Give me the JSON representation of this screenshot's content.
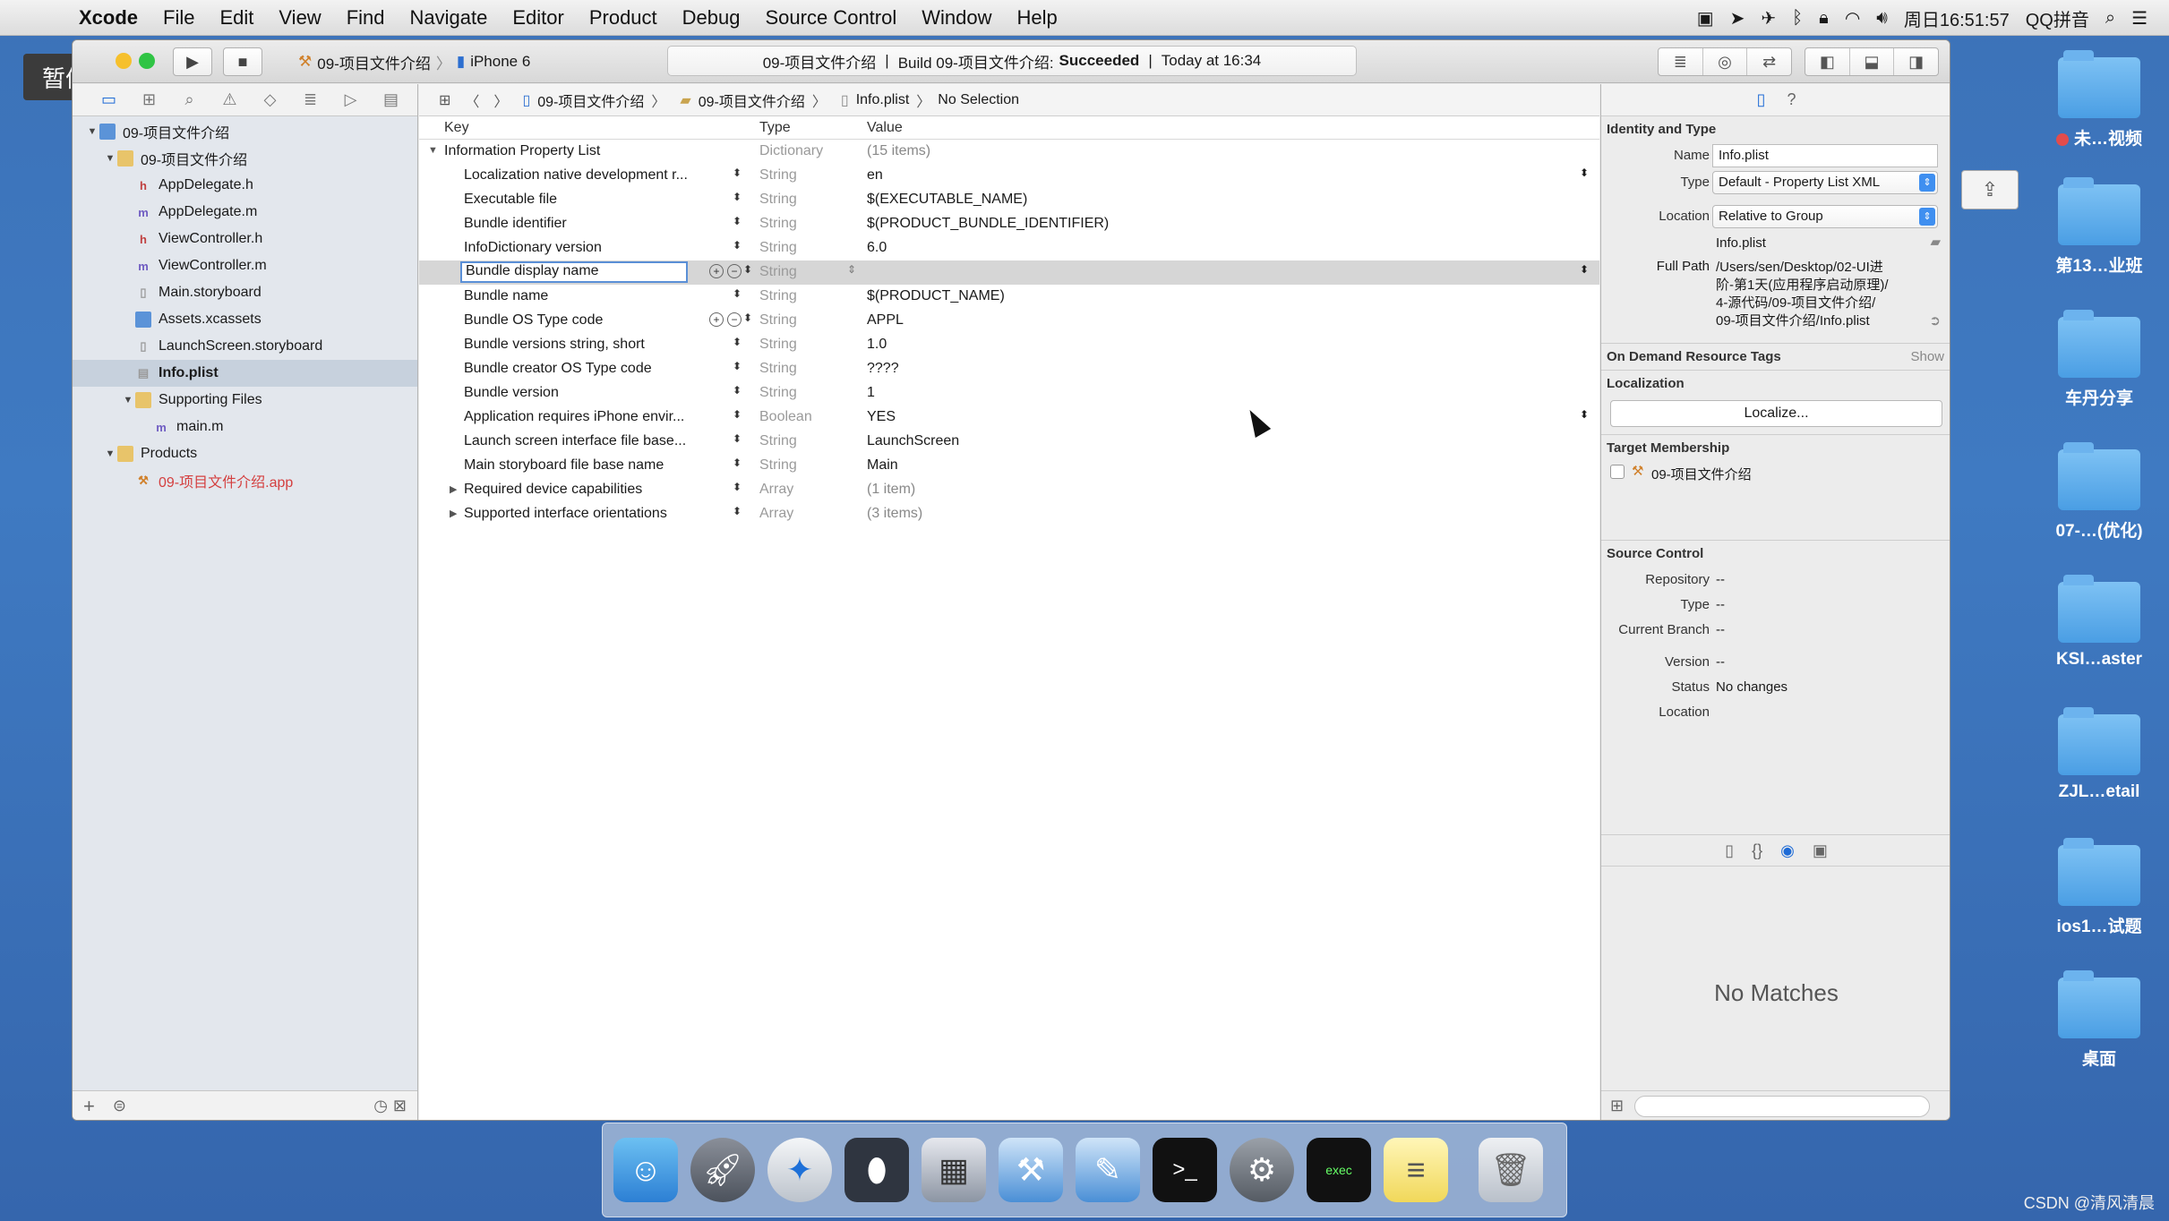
{
  "menubar": {
    "apple": "",
    "items": [
      "Xcode",
      "File",
      "Edit",
      "View",
      "Find",
      "Navigate",
      "Editor",
      "Product",
      "Debug",
      "Source Control",
      "Window",
      "Help"
    ],
    "clock": "周日16:51:57",
    "input_method": "QQ拼音"
  },
  "overlay": {
    "pause_label": "暂停"
  },
  "toolbar": {
    "scheme": "09-项目文件介绍",
    "device": "iPhone 6",
    "activity_project": "09-项目文件介绍",
    "activity_build": "Build 09-项目文件介绍:",
    "activity_status": "Succeeded",
    "activity_time": "Today at 16:34"
  },
  "navigator": {
    "tree": [
      {
        "label": "09-项目文件介绍",
        "indent": 1,
        "arrow": "▼",
        "icon": "xcodeproj"
      },
      {
        "label": "09-项目文件介绍",
        "indent": 2,
        "arrow": "▼",
        "icon": "folder"
      },
      {
        "label": "AppDelegate.h",
        "indent": 3,
        "arrow": "",
        "icon": "h"
      },
      {
        "label": "AppDelegate.m",
        "indent": 3,
        "arrow": "",
        "icon": "m"
      },
      {
        "label": "ViewController.h",
        "indent": 3,
        "arrow": "",
        "icon": "h"
      },
      {
        "label": "ViewController.m",
        "indent": 3,
        "arrow": "",
        "icon": "m"
      },
      {
        "label": "Main.storyboard",
        "indent": 3,
        "arrow": "",
        "icon": "sb"
      },
      {
        "label": "Assets.xcassets",
        "indent": 3,
        "arrow": "",
        "icon": "assets"
      },
      {
        "label": "LaunchScreen.storyboard",
        "indent": 3,
        "arrow": "",
        "icon": "sb"
      },
      {
        "label": "Info.plist",
        "indent": 3,
        "arrow": "",
        "icon": "plist",
        "selected": true
      },
      {
        "label": "Supporting Files",
        "indent": 3,
        "arrow": "▼",
        "icon": "folder"
      },
      {
        "label": "main.m",
        "indent": 4,
        "arrow": "",
        "icon": "m"
      },
      {
        "label": "Products",
        "indent": 2,
        "arrow": "▼",
        "icon": "folder"
      },
      {
        "label": "09-项目文件介绍.app",
        "indent": 3,
        "arrow": "",
        "icon": "app",
        "red": true
      }
    ]
  },
  "editor": {
    "jumpbar": [
      "09-项目文件介绍",
      "09-项目文件介绍",
      "Info.plist",
      "No Selection"
    ],
    "columns": {
      "key": "Key",
      "type": "Type",
      "value": "Value"
    },
    "rows": [
      {
        "key": "Information Property List",
        "type": "Dictionary",
        "value": "(15 items)",
        "top": true
      },
      {
        "key": "Localization native development r...",
        "type": "String",
        "value": "en"
      },
      {
        "key": "Executable file",
        "type": "String",
        "value": "$(EXECUTABLE_NAME)"
      },
      {
        "key": "Bundle identifier",
        "type": "String",
        "value": "$(PRODUCT_BUNDLE_IDENTIFIER)"
      },
      {
        "key": "InfoDictionary version",
        "type": "String",
        "value": "6.0"
      },
      {
        "key": "Bundle display name",
        "type": "String",
        "value": "",
        "editing": true
      },
      {
        "key": "Bundle name",
        "type": "String",
        "value": "$(PRODUCT_NAME)"
      },
      {
        "key": "Bundle OS Type code",
        "type": "String",
        "value": "APPL"
      },
      {
        "key": "Bundle versions string, short",
        "type": "String",
        "value": "1.0"
      },
      {
        "key": "Bundle creator OS Type code",
        "type": "String",
        "value": "????"
      },
      {
        "key": "Bundle version",
        "type": "String",
        "value": "1"
      },
      {
        "key": "Application requires iPhone envir...",
        "type": "Boolean",
        "value": "YES"
      },
      {
        "key": "Launch screen interface file base...",
        "type": "String",
        "value": "LaunchScreen"
      },
      {
        "key": "Main storyboard file base name",
        "type": "String",
        "value": "Main"
      },
      {
        "key": "Required device capabilities",
        "type": "Array",
        "value": "(1 item)",
        "collapsed": true
      },
      {
        "key": "Supported interface orientations",
        "type": "Array",
        "value": "(3 items)",
        "collapsed": true
      }
    ]
  },
  "inspector": {
    "identity_title": "Identity and Type",
    "name_label": "Name",
    "name_value": "Info.plist",
    "type_label": "Type",
    "type_value": "Default - Property List XML",
    "location_label": "Location",
    "location_value": "Relative to Group",
    "location_file": "Info.plist",
    "fullpath_label": "Full Path",
    "fullpath_lines": [
      "/Users/sen/Desktop/02-UI进",
      "阶-第1天(应用程序启动原理)/",
      "4-源代码/09-项目文件介绍/",
      "09-项目文件介绍/Info.plist"
    ],
    "odr_title": "On Demand Resource Tags",
    "odr_show": "Show",
    "localization_title": "Localization",
    "localize_button": "Localize...",
    "target_title": "Target Membership",
    "target_name": "09-项目文件介绍",
    "sc_title": "Source Control",
    "sc_rows": [
      {
        "label": "Repository",
        "value": "--"
      },
      {
        "label": "Type",
        "value": "--"
      },
      {
        "label": "Current Branch",
        "value": "--"
      },
      {
        "label": "Version",
        "value": "--"
      },
      {
        "label": "Status",
        "value": "No changes"
      },
      {
        "label": "Location",
        "value": ""
      }
    ],
    "no_matches": "No Matches"
  },
  "desktop": {
    "icons": [
      "未…视频",
      "第13…业班",
      "车丹分享",
      "07-…(优化)",
      "KSI…aster",
      "ZJL…etail",
      "ios1…试题",
      "桌面"
    ]
  },
  "dock": {
    "apps": [
      "finder-icon",
      "launchpad-icon",
      "safari-icon",
      "mouse-icon",
      "preview-icon",
      "xcode-icon",
      "instruments-icon",
      "terminal-icon",
      "system-preferences-icon",
      "exec-icon",
      "notes-icon",
      "trash-icon"
    ]
  },
  "watermark": "CSDN @清风清晨",
  "colors": {
    "selection": "#c7d1dd",
    "accent": "#1e6bd6",
    "desktop": "#3f7ac2"
  }
}
